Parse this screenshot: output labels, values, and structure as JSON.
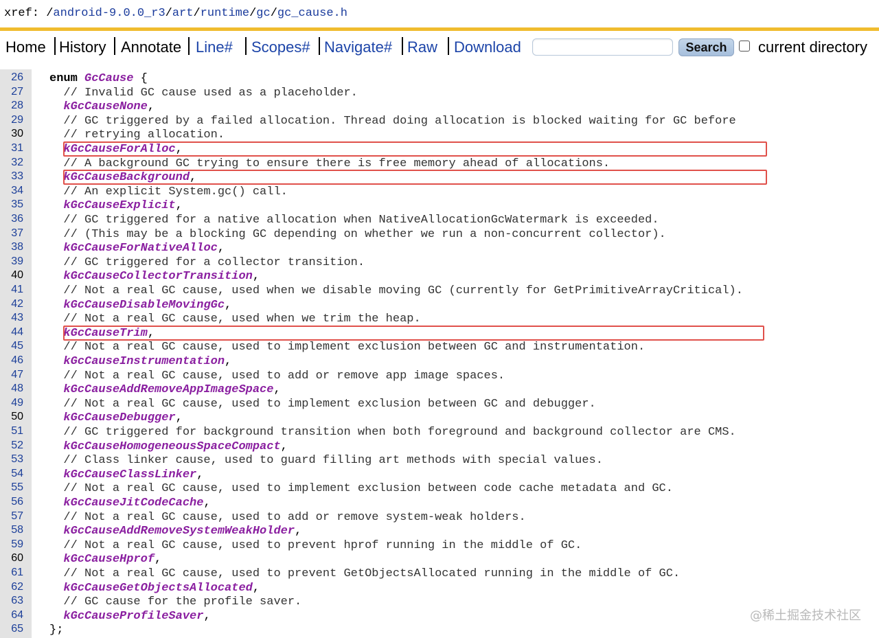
{
  "xref": {
    "prefix": "xref: /",
    "path": [
      {
        "text": "android-9.0.0_r3",
        "link": true
      },
      {
        "text": "/",
        "link": false
      },
      {
        "text": "art",
        "link": true
      },
      {
        "text": "/",
        "link": false
      },
      {
        "text": "runtime",
        "link": true
      },
      {
        "text": "/",
        "link": false
      },
      {
        "text": "gc",
        "link": true
      },
      {
        "text": "/",
        "link": false
      },
      {
        "text": "gc_cause.h",
        "link": true
      }
    ]
  },
  "nav": {
    "items": [
      {
        "label": "Home",
        "link": false
      },
      {
        "label": "History",
        "link": false
      },
      {
        "label": "Annotate",
        "link": false
      },
      {
        "label": "Line#",
        "link": true
      },
      {
        "label": "Scopes#",
        "link": true
      },
      {
        "label": "Navigate#",
        "link": true
      },
      {
        "label": "Raw",
        "link": true
      },
      {
        "label": "Download",
        "link": true
      }
    ],
    "search_value": "",
    "search_button": "Search",
    "current_directory_label": "current directory",
    "current_directory_checked": false
  },
  "code": {
    "lines": [
      {
        "n": "26",
        "t": "enum",
        "parts": [
          {
            "k": "kw",
            "v": "enum "
          },
          {
            "k": "ident",
            "v": "GcCause"
          },
          {
            "k": "",
            "v": " {"
          }
        ]
      },
      {
        "n": "27",
        "parts": [
          {
            "k": "comment",
            "v": "  // Invalid GC cause used as a placeholder."
          }
        ]
      },
      {
        "n": "28",
        "parts": [
          {
            "k": "",
            "v": "  "
          },
          {
            "k": "ident",
            "v": "kGcCauseNone"
          },
          {
            "k": "",
            "v": ","
          }
        ]
      },
      {
        "n": "29",
        "parts": [
          {
            "k": "comment",
            "v": "  // GC triggered by a failed allocation. Thread doing allocation is blocked waiting for GC before"
          }
        ]
      },
      {
        "n": "30",
        "plain": true,
        "parts": [
          {
            "k": "comment",
            "v": "  // retrying allocation."
          }
        ]
      },
      {
        "n": "31",
        "parts": [
          {
            "k": "",
            "v": "  "
          },
          {
            "k": "ident",
            "v": "kGcCauseForAlloc"
          },
          {
            "k": "",
            "v": ","
          }
        ]
      },
      {
        "n": "32",
        "parts": [
          {
            "k": "comment",
            "v": "  // A background GC trying to ensure there is free memory ahead of allocations."
          }
        ]
      },
      {
        "n": "33",
        "parts": [
          {
            "k": "",
            "v": "  "
          },
          {
            "k": "ident",
            "v": "kGcCauseBackground"
          },
          {
            "k": "",
            "v": ","
          }
        ]
      },
      {
        "n": "34",
        "parts": [
          {
            "k": "comment",
            "v": "  // An explicit System.gc() call."
          }
        ]
      },
      {
        "n": "35",
        "parts": [
          {
            "k": "",
            "v": "  "
          },
          {
            "k": "ident",
            "v": "kGcCauseExplicit"
          },
          {
            "k": "",
            "v": ","
          }
        ]
      },
      {
        "n": "36",
        "parts": [
          {
            "k": "comment",
            "v": "  // GC triggered for a native allocation when NativeAllocationGcWatermark is exceeded."
          }
        ]
      },
      {
        "n": "37",
        "parts": [
          {
            "k": "comment",
            "v": "  // (This may be a blocking GC depending on whether we run a non-concurrent collector)."
          }
        ]
      },
      {
        "n": "38",
        "parts": [
          {
            "k": "",
            "v": "  "
          },
          {
            "k": "ident",
            "v": "kGcCauseForNativeAlloc"
          },
          {
            "k": "",
            "v": ","
          }
        ]
      },
      {
        "n": "39",
        "parts": [
          {
            "k": "comment",
            "v": "  // GC triggered for a collector transition."
          }
        ]
      },
      {
        "n": "40",
        "plain": true,
        "parts": [
          {
            "k": "",
            "v": "  "
          },
          {
            "k": "ident",
            "v": "kGcCauseCollectorTransition"
          },
          {
            "k": "",
            "v": ","
          }
        ]
      },
      {
        "n": "41",
        "parts": [
          {
            "k": "comment",
            "v": "  // Not a real GC cause, used when we disable moving GC (currently for GetPrimitiveArrayCritical)."
          }
        ]
      },
      {
        "n": "42",
        "parts": [
          {
            "k": "",
            "v": "  "
          },
          {
            "k": "ident",
            "v": "kGcCauseDisableMovingGc"
          },
          {
            "k": "",
            "v": ","
          }
        ]
      },
      {
        "n": "43",
        "parts": [
          {
            "k": "comment",
            "v": "  // Not a real GC cause, used when we trim the heap."
          }
        ]
      },
      {
        "n": "44",
        "parts": [
          {
            "k": "",
            "v": "  "
          },
          {
            "k": "ident",
            "v": "kGcCauseTrim"
          },
          {
            "k": "",
            "v": ","
          }
        ]
      },
      {
        "n": "45",
        "parts": [
          {
            "k": "comment",
            "v": "  // Not a real GC cause, used to implement exclusion between GC and instrumentation."
          }
        ]
      },
      {
        "n": "46",
        "parts": [
          {
            "k": "",
            "v": "  "
          },
          {
            "k": "ident",
            "v": "kGcCauseInstrumentation"
          },
          {
            "k": "",
            "v": ","
          }
        ]
      },
      {
        "n": "47",
        "parts": [
          {
            "k": "comment",
            "v": "  // Not a real GC cause, used to add or remove app image spaces."
          }
        ]
      },
      {
        "n": "48",
        "parts": [
          {
            "k": "",
            "v": "  "
          },
          {
            "k": "ident",
            "v": "kGcCauseAddRemoveAppImageSpace"
          },
          {
            "k": "",
            "v": ","
          }
        ]
      },
      {
        "n": "49",
        "parts": [
          {
            "k": "comment",
            "v": "  // Not a real GC cause, used to implement exclusion between GC and debugger."
          }
        ]
      },
      {
        "n": "50",
        "plain": true,
        "parts": [
          {
            "k": "",
            "v": "  "
          },
          {
            "k": "ident",
            "v": "kGcCauseDebugger"
          },
          {
            "k": "",
            "v": ","
          }
        ]
      },
      {
        "n": "51",
        "parts": [
          {
            "k": "comment",
            "v": "  // GC triggered for background transition when both foreground and background collector are CMS."
          }
        ]
      },
      {
        "n": "52",
        "parts": [
          {
            "k": "",
            "v": "  "
          },
          {
            "k": "ident",
            "v": "kGcCauseHomogeneousSpaceCompact"
          },
          {
            "k": "",
            "v": ","
          }
        ]
      },
      {
        "n": "53",
        "parts": [
          {
            "k": "comment",
            "v": "  // Class linker cause, used to guard filling art methods with special values."
          }
        ]
      },
      {
        "n": "54",
        "parts": [
          {
            "k": "",
            "v": "  "
          },
          {
            "k": "ident",
            "v": "kGcCauseClassLinker"
          },
          {
            "k": "",
            "v": ","
          }
        ]
      },
      {
        "n": "55",
        "parts": [
          {
            "k": "comment",
            "v": "  // Not a real GC cause, used to implement exclusion between code cache metadata and GC."
          }
        ]
      },
      {
        "n": "56",
        "parts": [
          {
            "k": "",
            "v": "  "
          },
          {
            "k": "ident",
            "v": "kGcCauseJitCodeCache"
          },
          {
            "k": "",
            "v": ","
          }
        ]
      },
      {
        "n": "57",
        "parts": [
          {
            "k": "comment",
            "v": "  // Not a real GC cause, used to add or remove system-weak holders."
          }
        ]
      },
      {
        "n": "58",
        "parts": [
          {
            "k": "",
            "v": "  "
          },
          {
            "k": "ident",
            "v": "kGcCauseAddRemoveSystemWeakHolder"
          },
          {
            "k": "",
            "v": ","
          }
        ]
      },
      {
        "n": "59",
        "parts": [
          {
            "k": "comment",
            "v": "  // Not a real GC cause, used to prevent hprof running in the middle of GC."
          }
        ]
      },
      {
        "n": "60",
        "plain": true,
        "parts": [
          {
            "k": "",
            "v": "  "
          },
          {
            "k": "ident",
            "v": "kGcCauseHprof"
          },
          {
            "k": "",
            "v": ","
          }
        ]
      },
      {
        "n": "61",
        "parts": [
          {
            "k": "comment",
            "v": "  // Not a real GC cause, used to prevent GetObjectsAllocated running in the middle of GC."
          }
        ]
      },
      {
        "n": "62",
        "parts": [
          {
            "k": "",
            "v": "  "
          },
          {
            "k": "ident",
            "v": "kGcCauseGetObjectsAllocated"
          },
          {
            "k": "",
            "v": ","
          }
        ]
      },
      {
        "n": "63",
        "parts": [
          {
            "k": "comment",
            "v": "  // GC cause for the profile saver."
          }
        ]
      },
      {
        "n": "64",
        "parts": [
          {
            "k": "",
            "v": "  "
          },
          {
            "k": "ident",
            "v": "kGcCauseProfileSaver"
          },
          {
            "k": "",
            "v": ","
          }
        ]
      },
      {
        "n": "65",
        "parts": [
          {
            "k": "",
            "v": "};"
          }
        ]
      }
    ],
    "highlighted_lines": [
      "31",
      "33",
      "44"
    ]
  },
  "colors": {
    "identifier": "#8a1fa0",
    "line_number_link": "#1c3f99",
    "nav_link": "#1c44a8",
    "highlight_box": "#e0504a",
    "header_rule": "#f0bc2e"
  },
  "watermark": "@稀土掘金技术社区"
}
